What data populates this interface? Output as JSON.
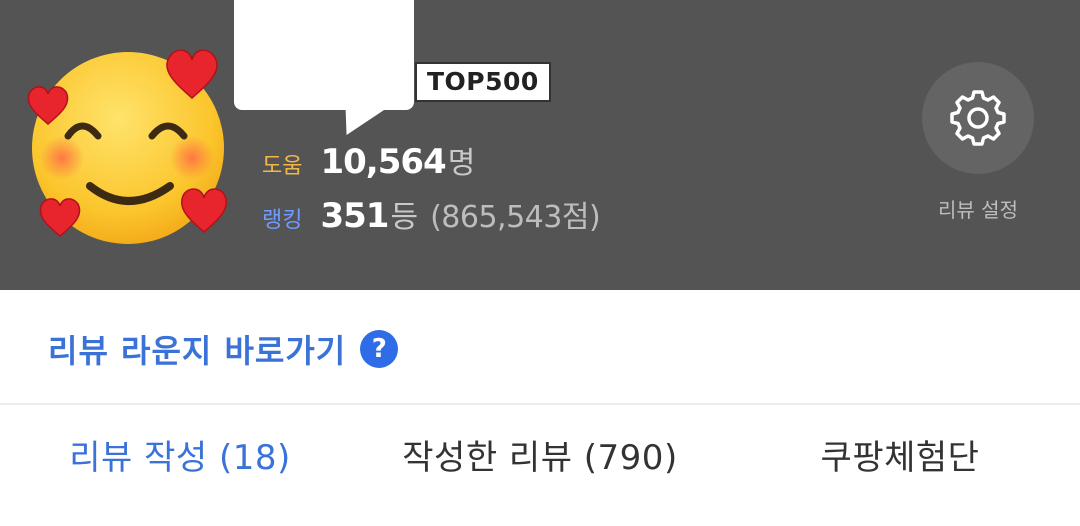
{
  "header": {
    "badge": "TOP500",
    "help": {
      "label": "도움",
      "value": "10,564",
      "unit": "명"
    },
    "rank": {
      "label": "랭킹",
      "value": "351",
      "unit": "등",
      "points": "(865,543점)"
    },
    "settings": {
      "icon": "gear-icon",
      "label": "리뷰 설정"
    },
    "avatar": {
      "icon": "smiling-face-with-hearts-emoji"
    }
  },
  "lounge": {
    "label": "리뷰 라운지 바로가기",
    "help_icon": "?"
  },
  "tabs": [
    {
      "label": "리뷰 작성 (18)",
      "active": true
    },
    {
      "label": "작성한 리뷰 (790)",
      "active": false
    },
    {
      "label": "쿠팡체험단",
      "active": false
    }
  ],
  "colors": {
    "header_bg": "#545454",
    "accent_blue": "#3a72d8",
    "help_label": "#f2b64a",
    "rank_label": "#6f9bff"
  }
}
